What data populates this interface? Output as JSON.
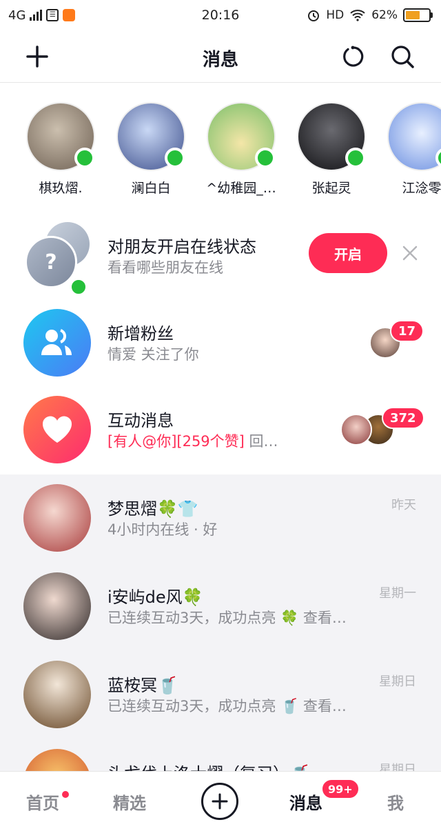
{
  "status_bar": {
    "network": "4G",
    "time": "20:16",
    "hd": "HD",
    "battery_pct": "62%",
    "battery_level": 0.62
  },
  "header": {
    "title": "消息",
    "add_icon": "plus-icon",
    "refresh_icon": "refresh-icon",
    "search_icon": "search-icon"
  },
  "friends": [
    {
      "name": "棋玖熠.",
      "color": "#8a7a6a"
    },
    {
      "name": "澜白白",
      "color": "#5a6fa8"
    },
    {
      "name": "^幼稚园_…",
      "color": "#e8d27a"
    },
    {
      "name": "张起灵",
      "color": "#2a2a2e"
    },
    {
      "name": "江淰零",
      "color": "#7aa6e0"
    }
  ],
  "online_prompt": {
    "title": "对朋友开启在线状态",
    "subtitle": "看看哪些朋友在线",
    "button": "开启"
  },
  "new_fans": {
    "title": "新增粉丝",
    "subtitle": "情爱 关注了你",
    "badge": "17"
  },
  "interactions": {
    "title": "互动消息",
    "highlight": "[有人@你][259个赞]",
    "rest": " 回…",
    "badge": "372"
  },
  "chats": [
    {
      "name": "梦思熠🍀👕",
      "preview": "4小时内在线 · 好",
      "time": "昨天",
      "color": "#c85a5a"
    },
    {
      "name": "i安屿de风🍀",
      "preview": "已连续互动3天，成功点亮 🍀 查看…",
      "time": "星期一",
      "color": "#3a3a3a"
    },
    {
      "name": "蓝桉冥🥤",
      "preview": "已连续互动3天，成功点亮 🥤 查看…",
      "time": "星期日",
      "color": "#7a5a3a"
    },
    {
      "name": "头戈伐上洛士熠（复习）🥤",
      "preview": "",
      "time": "星期日",
      "color": "#e08a3a"
    }
  ],
  "tabbar": {
    "home": "首页",
    "featured": "精选",
    "messages": "消息",
    "messages_badge": "99+",
    "me": "我"
  },
  "colors": {
    "accent": "#fe2c55",
    "online": "#25c03a",
    "fans_gradient": [
      "#1ec8f0",
      "#4b7bf5"
    ],
    "interact_gradient": [
      "#ff7a4a",
      "#fe2c6e"
    ]
  }
}
